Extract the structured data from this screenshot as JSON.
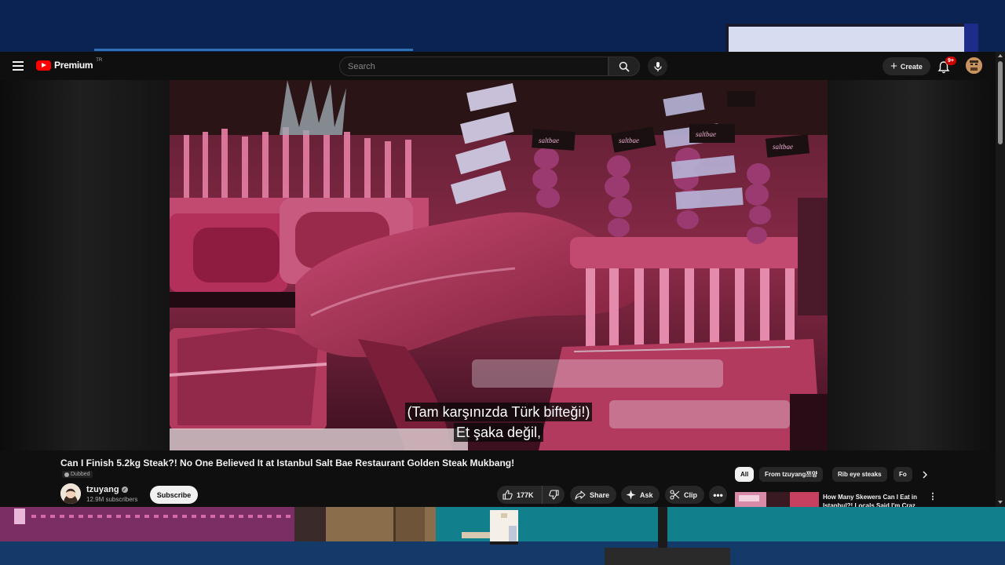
{
  "header": {
    "logo_text": "Premium",
    "region_code": "TR",
    "search_placeholder": "Search",
    "create_label": "Create",
    "notification_count": "9+"
  },
  "video": {
    "caption_line1": "(Tam karşınızda Türk bifteği!)",
    "caption_line2": "Et şaka değil,",
    "title": "Can I Finish 5.2kg Steak?! No One Believed It at Istanbul Salt Bae Restaurant Golden Steak Mukbang!",
    "audio_badge": "Dubbed",
    "sign_text": "saltbae"
  },
  "channel": {
    "name": "tzuyang",
    "subscribers": "12.9M subscribers",
    "subscribe_label": "Subscribe"
  },
  "actions": {
    "like_count": "177K",
    "share_label": "Share",
    "ask_label": "Ask",
    "clip_label": "Clip",
    "more_label": "•••"
  },
  "chips": [
    {
      "label": "All",
      "active": true
    },
    {
      "label": "From tzuyang쯔양",
      "active": false
    },
    {
      "label": "Rib eye steaks",
      "active": false
    },
    {
      "label": "Fo",
      "active": false
    }
  ],
  "recommendation": {
    "title": "How Many Skewers Can I Eat in Istanbul?! Locals Said I'm Craz"
  },
  "icons": {
    "menu": "menu-icon",
    "search": "search-icon",
    "mic": "mic-icon",
    "bell": "bell-icon",
    "like": "thumbs-up-icon",
    "dislike": "thumbs-down-icon",
    "share": "share-icon",
    "ask": "sparkle-icon",
    "clip": "scissors-icon",
    "chip_next": "chevron-right-icon"
  },
  "colors": {
    "brand_red": "#ff0000",
    "background": "#0f0f0f",
    "pill": "#272727"
  }
}
